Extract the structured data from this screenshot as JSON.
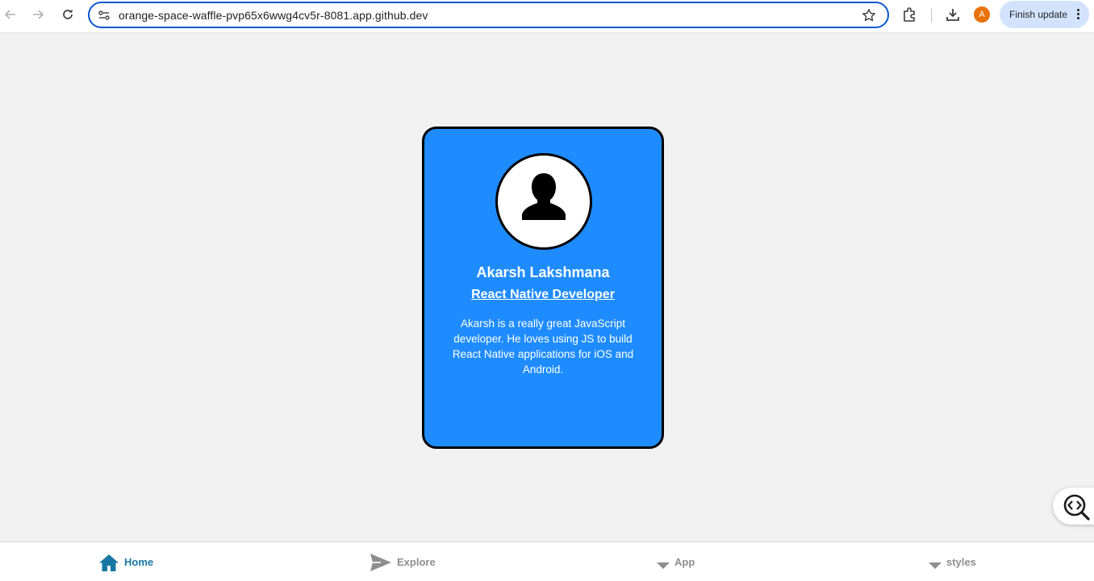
{
  "browser": {
    "url": "orange-space-waffle-pvp65x6wwg4cv5r-8081.app.github.dev",
    "profile_initial": "A",
    "finish_update_label": "Finish update",
    "colors": {
      "omnibox_border": "#0b57d0",
      "profile": "#e8710a",
      "update_button": "#d3e3fd"
    }
  },
  "card": {
    "name": "Akarsh Lakshmana",
    "role": "React Native Developer",
    "bio": "Akarsh is a really great JavaScript developer. He loves using JS to build React Native applications for iOS and Android.",
    "colors": {
      "background": "#1e8cff",
      "border": "#000000"
    }
  },
  "tabs": [
    {
      "label": "Home",
      "icon": "home-icon",
      "active": true
    },
    {
      "label": "Explore",
      "icon": "send-icon",
      "active": false
    },
    {
      "label": "App",
      "icon": "caret-down-icon",
      "active": false
    },
    {
      "label": "styles",
      "icon": "caret-down-icon",
      "active": false
    }
  ],
  "tab_colors": {
    "active": "#1677a3",
    "inactive": "#8e8e8f"
  }
}
